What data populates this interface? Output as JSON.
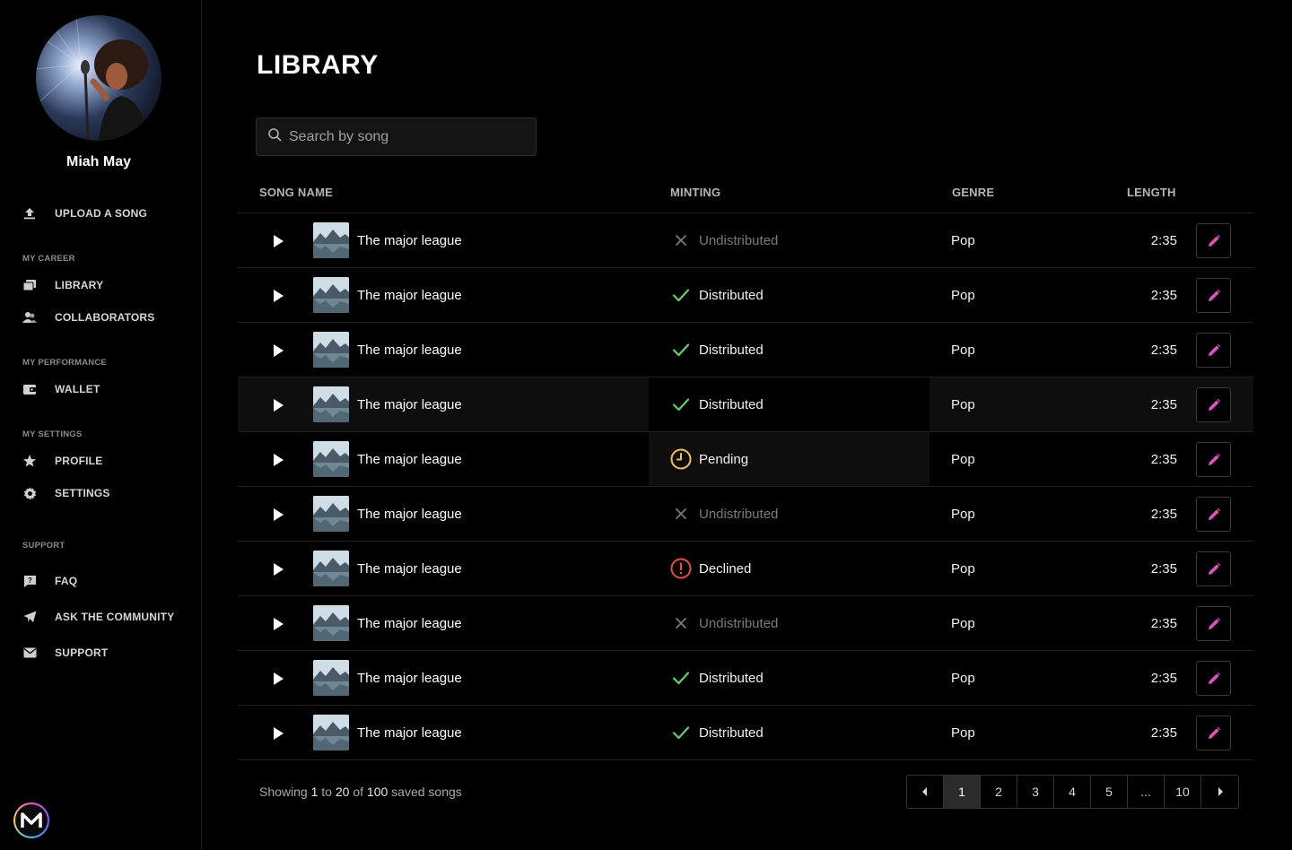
{
  "user": {
    "name": "Miah May"
  },
  "nav": {
    "upload": "UPLOAD A SONG",
    "sections": {
      "career": "MY CAREER",
      "performance": "MY PERFORMANCE",
      "settings": "MY SETTINGS",
      "support": "SUPPORT"
    },
    "items": {
      "library": "LIBRARY",
      "collaborators": "COLLABORATORS",
      "wallet": "WALLET",
      "profile": "PROFILE",
      "settings": "SETTINGS",
      "faq": "FAQ",
      "community": "ASK THE COMMUNITY",
      "support": "SUPPORT"
    }
  },
  "page": {
    "title": "LIBRARY"
  },
  "search": {
    "placeholder": "Search by song"
  },
  "table": {
    "columns": {
      "song": "SONG NAME",
      "minting": "MINTING",
      "genre": "GENRE",
      "length": "LENGTH"
    },
    "rows": [
      {
        "title": "The major league",
        "status": "Undistributed",
        "genre": "Pop",
        "length": "2:35"
      },
      {
        "title": "The major league",
        "status": "Distributed",
        "genre": "Pop",
        "length": "2:35"
      },
      {
        "title": "The major league",
        "status": "Distributed",
        "genre": "Pop",
        "length": "2:35"
      },
      {
        "title": "The major league",
        "status": "Distributed",
        "genre": "Pop",
        "length": "2:35"
      },
      {
        "title": "The major league",
        "status": "Pending",
        "genre": "Pop",
        "length": "2:35"
      },
      {
        "title": "The major league",
        "status": "Undistributed",
        "genre": "Pop",
        "length": "2:35"
      },
      {
        "title": "The major league",
        "status": "Declined",
        "genre": "Pop",
        "length": "2:35"
      },
      {
        "title": "The major league",
        "status": "Undistributed",
        "genre": "Pop",
        "length": "2:35"
      },
      {
        "title": "The major league",
        "status": "Distributed",
        "genre": "Pop",
        "length": "2:35"
      },
      {
        "title": "The major league",
        "status": "Distributed",
        "genre": "Pop",
        "length": "2:35"
      }
    ]
  },
  "footer": {
    "prefix": "Showing",
    "from": "1",
    "to_word": "to",
    "to": "20",
    "of_word": "of",
    "total": "100",
    "suffix": "saved songs"
  },
  "pagination": {
    "pages": [
      "1",
      "2",
      "3",
      "4",
      "5",
      "...",
      "10"
    ],
    "current": "1"
  },
  "colors": {
    "accent": "#e24fc0",
    "distributed": "#5fd36b",
    "pending": "#f2c14e",
    "declined": "#ea4a4a",
    "undistributed": "#7a7a7a"
  },
  "icons": {
    "upload": "upload-icon",
    "library": "library-icon",
    "collaborators": "collaborators-icon",
    "wallet": "wallet-icon",
    "profile": "star-icon",
    "settings": "gear-icon",
    "faq": "faq-icon",
    "community": "paper-plane-icon",
    "support": "mail-icon",
    "play": "play-icon",
    "edit": "pencil-icon",
    "search": "search-icon"
  }
}
